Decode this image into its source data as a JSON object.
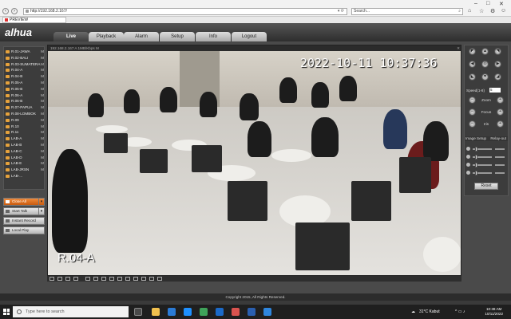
{
  "browser": {
    "url": "http://192.168.2.167/",
    "search_placeholder": "Search...",
    "tab_title": "PREVIEW"
  },
  "app": {
    "logo": "alhua",
    "menu": [
      {
        "label": "Live",
        "active": true
      },
      {
        "label": "Playback"
      },
      {
        "label": "Alarm"
      },
      {
        "label": "Setup"
      },
      {
        "label": "Info"
      },
      {
        "label": "Logout"
      }
    ]
  },
  "channels": [
    {
      "label": "R.01-JAWA",
      "mode": "M"
    },
    {
      "label": "R.02-BALI",
      "mode": "M"
    },
    {
      "label": "R.03-SUMATERA",
      "mode": "M"
    },
    {
      "label": "R.04-A",
      "mode": "M"
    },
    {
      "label": "R.04-B",
      "mode": "M"
    },
    {
      "label": "R.05-A",
      "mode": "M"
    },
    {
      "label": "R.05-B",
      "mode": "M"
    },
    {
      "label": "R.06-A",
      "mode": "M"
    },
    {
      "label": "R.06-B",
      "mode": "M"
    },
    {
      "label": "R.07-PAPUA",
      "mode": "M"
    },
    {
      "label": "R.08-LOMBOK",
      "mode": "M"
    },
    {
      "label": "R.09",
      "mode": "M"
    },
    {
      "label": "R.10",
      "mode": "M"
    },
    {
      "label": "R.11",
      "mode": "M"
    },
    {
      "label": "LAB-A",
      "mode": "M"
    },
    {
      "label": "LAB-B",
      "mode": "M"
    },
    {
      "label": "LAB-C",
      "mode": "M"
    },
    {
      "label": "LAB-D",
      "mode": "M"
    },
    {
      "label": "LAB-E",
      "mode": "M"
    },
    {
      "label": "LAB-JRSN",
      "mode": "M"
    },
    {
      "label": "LAB-...",
      "mode": ""
    }
  ],
  "controls": {
    "close_all": "Close All",
    "start_talk": "Start Talk",
    "instant_record": "Instant Record",
    "local_play": "Local Play"
  },
  "video": {
    "stream_info": "192.168.2.167 A 1MB/Kbps M",
    "timestamp": "2022-10-11 10:37:36",
    "room_label": "R.04-A"
  },
  "ptz": {
    "speed_label": "Speed(1-8)",
    "speed_value": "5",
    "zoom_label": "Zoom",
    "focus_label": "Focus",
    "iris_label": "Iris",
    "image_setup": "Image Setup",
    "relay_out": "Relay-out",
    "reset": "Reset"
  },
  "footer": {
    "copyright": "Copyright 2015, All Rights Reserved."
  },
  "taskbar": {
    "search_placeholder": "Type here to search",
    "weather": "31°C  Kabut",
    "time": "10:38 AM",
    "date": "10/11/2022"
  },
  "colors": {
    "accent_orange": "#e07a24",
    "channel_icon": "#e6a23c"
  }
}
